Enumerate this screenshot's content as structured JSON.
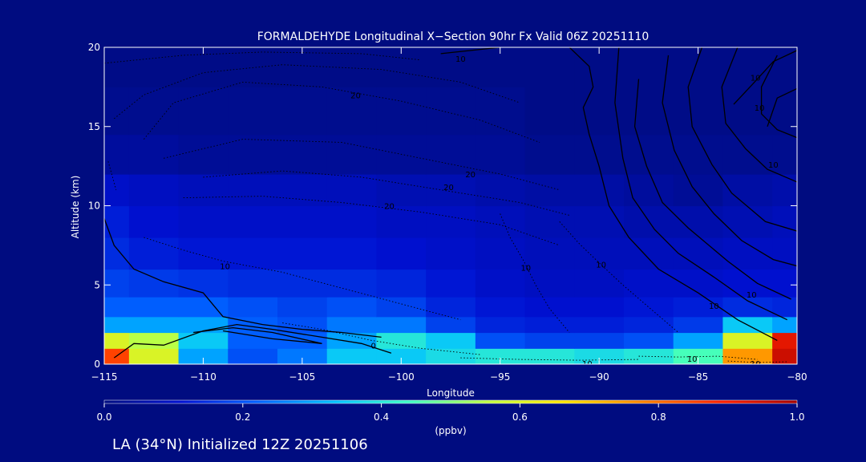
{
  "chart_data": {
    "type": "heatmap",
    "title": "FORMALDEHYDE Longitudinal X−Section 90hr  Fx Valid 06Z 20251110",
    "xlabel": "Longitude",
    "ylabel": "Altitude (km)",
    "xlim": [
      -115,
      -80
    ],
    "ylim": [
      0,
      20
    ],
    "x_ticks": [
      -115,
      -110,
      -105,
      -100,
      -95,
      -90,
      -85,
      -80
    ],
    "x_tick_labels": [
      "−115",
      "−110",
      "−105",
      "−100",
      "−95",
      "−90",
      "−85",
      "−80"
    ],
    "y_ticks": [
      0,
      5,
      10,
      15,
      20
    ],
    "y_tick_labels": [
      "0",
      "5",
      "10",
      "15",
      "20"
    ],
    "colorbar": {
      "label": "(ppbv)",
      "range": [
        0.0,
        1.0
      ],
      "ticks": [
        0.0,
        0.2,
        0.4,
        0.6,
        0.8,
        1.0
      ],
      "tick_labels": [
        "0.0",
        "0.2",
        "0.4",
        "0.6",
        "0.8",
        "1.0"
      ],
      "colors": [
        "#000c80",
        "#0010d0",
        "#0060ff",
        "#00c0ff",
        "#40ffc0",
        "#c0ff40",
        "#ffe000",
        "#ff8000",
        "#ff2000",
        "#a00000"
      ]
    },
    "longitudes": [
      -115,
      -112.5,
      -110,
      -107.5,
      -105,
      -102.5,
      -100,
      -97.5,
      -95,
      -92.5,
      -90,
      -87.5,
      -85,
      -82.5,
      -80
    ],
    "altitude_rows": [
      {
        "z": 0.5,
        "values": [
          0.85,
          0.6,
          0.3,
          0.2,
          0.25,
          0.35,
          0.35,
          0.38,
          0.4,
          0.4,
          0.38,
          0.4,
          0.45,
          0.75,
          0.95
        ]
      },
      {
        "z": 1.5,
        "values": [
          0.6,
          0.55,
          0.35,
          0.22,
          0.22,
          0.3,
          0.4,
          0.35,
          0.2,
          0.18,
          0.18,
          0.2,
          0.3,
          0.6,
          0.92
        ]
      },
      {
        "z": 2.5,
        "values": [
          0.3,
          0.3,
          0.3,
          0.22,
          0.2,
          0.25,
          0.25,
          0.18,
          0.14,
          0.13,
          0.13,
          0.14,
          0.17,
          0.35,
          0.3
        ]
      },
      {
        "z": 3.5,
        "values": [
          0.22,
          0.22,
          0.22,
          0.2,
          0.18,
          0.2,
          0.18,
          0.14,
          0.12,
          0.11,
          0.11,
          0.12,
          0.13,
          0.15,
          0.14
        ]
      },
      {
        "z": 5,
        "values": [
          0.18,
          0.17,
          0.16,
          0.15,
          0.15,
          0.15,
          0.14,
          0.12,
          0.1,
          0.09,
          0.09,
          0.1,
          0.1,
          0.11,
          0.11
        ]
      },
      {
        "z": 7,
        "values": [
          0.15,
          0.13,
          0.12,
          0.12,
          0.12,
          0.12,
          0.11,
          0.1,
          0.09,
          0.08,
          0.08,
          0.08,
          0.08,
          0.09,
          0.09
        ]
      },
      {
        "z": 9,
        "values": [
          0.13,
          0.11,
          0.1,
          0.1,
          0.1,
          0.1,
          0.09,
          0.09,
          0.08,
          0.07,
          0.07,
          0.06,
          0.06,
          0.07,
          0.08
        ]
      },
      {
        "z": 11,
        "values": [
          0.1,
          0.09,
          0.08,
          0.08,
          0.08,
          0.08,
          0.07,
          0.07,
          0.06,
          0.05,
          0.05,
          0.04,
          0.03,
          0.05,
          0.06
        ]
      },
      {
        "z": 13,
        "values": [
          0.04,
          0.04,
          0.03,
          0.03,
          0.03,
          0.03,
          0.03,
          0.03,
          0.03,
          0.02,
          0.02,
          0.02,
          0.02,
          0.02,
          0.02
        ]
      },
      {
        "z": 16,
        "values": [
          0.02,
          0.02,
          0.02,
          0.02,
          0.02,
          0.02,
          0.02,
          0.02,
          0.02,
          0.01,
          0.01,
          0.01,
          0.01,
          0.01,
          0.01
        ]
      },
      {
        "z": 19,
        "values": [
          0.01,
          0.01,
          0.01,
          0.01,
          0.01,
          0.01,
          0.01,
          0.01,
          0.01,
          0.01,
          0.01,
          0.01,
          0.01,
          0.01,
          0.01
        ]
      }
    ],
    "contours": [
      {
        "style": "solid",
        "label": "",
        "label_at": null,
        "points": [
          [
            -115,
            9.2
          ],
          [
            -114.5,
            7.5
          ],
          [
            -113.5,
            6.0
          ],
          [
            -112,
            5.2
          ],
          [
            -110,
            4.5
          ],
          [
            -109,
            3.0
          ],
          [
            -107,
            2.5
          ],
          [
            -105,
            2.2
          ],
          [
            -103,
            2.0
          ],
          [
            -101,
            1.7
          ]
        ]
      },
      {
        "style": "solid",
        "label": "",
        "label_at": null,
        "points": [
          [
            -114.5,
            0.4
          ],
          [
            -113.5,
            1.3
          ],
          [
            -112,
            1.2
          ],
          [
            -110,
            2.1
          ],
          [
            -108.3,
            2.5
          ],
          [
            -106.5,
            2.2
          ],
          [
            -104,
            1.7
          ],
          [
            -102,
            1.3
          ],
          [
            -100.5,
            0.7
          ]
        ]
      },
      {
        "style": "solid",
        "label": "",
        "label_at": null,
        "points": [
          [
            -110.5,
            2.0
          ],
          [
            -108.5,
            2.3
          ],
          [
            -106.5,
            2.0
          ],
          [
            -104,
            1.3
          ],
          [
            -106.5,
            1.6
          ],
          [
            -109,
            2.1
          ]
        ]
      },
      {
        "style": "solid",
        "label": "10",
        "label_at": [
          -97,
          19.3
        ],
        "points": [
          [
            -98,
            19.6
          ],
          [
            -95,
            20
          ]
        ]
      },
      {
        "style": "solid",
        "label": "",
        "label_at": null,
        "points": [
          [
            -91.5,
            20
          ],
          [
            -90.5,
            18.8
          ],
          [
            -90.3,
            17.5
          ],
          [
            -90.8,
            16.2
          ],
          [
            -90.5,
            14.5
          ],
          [
            -90,
            12.5
          ],
          [
            -89.5,
            10.0
          ],
          [
            -88.5,
            8.0
          ],
          [
            -87,
            6.0
          ],
          [
            -85,
            4.5
          ],
          [
            -83,
            2.8
          ],
          [
            -81,
            1.5
          ]
        ]
      },
      {
        "style": "solid",
        "label": "10",
        "label_at": [
          -84.2,
          3.7
        ],
        "points": [
          [
            -89,
            20
          ],
          [
            -89.2,
            16.5
          ],
          [
            -88.8,
            13.0
          ],
          [
            -88.3,
            10.5
          ],
          [
            -87.2,
            8.5
          ],
          [
            -86,
            7.0
          ],
          [
            -84.2,
            5.5
          ],
          [
            -82.5,
            4.0
          ],
          [
            -80.5,
            2.8
          ]
        ]
      },
      {
        "style": "solid",
        "label": "",
        "label_at": null,
        "points": [
          [
            -88,
            18.0
          ],
          [
            -88.2,
            15.0
          ],
          [
            -87.6,
            12.5
          ],
          [
            -86.8,
            10.2
          ],
          [
            -85.5,
            8.6
          ],
          [
            -83.5,
            6.5
          ],
          [
            -82,
            5.1
          ],
          [
            -80.3,
            4.1
          ]
        ]
      },
      {
        "style": "solid",
        "label": "10",
        "label_at": [
          -82.3,
          4.4
        ],
        "points": [
          [
            -86.5,
            19.5
          ],
          [
            -86.8,
            16.5
          ],
          [
            -86.2,
            13.5
          ],
          [
            -85.3,
            11.2
          ],
          [
            -84.2,
            9.5
          ],
          [
            -82.8,
            7.8
          ],
          [
            -81.2,
            6.6
          ],
          [
            -80,
            6.2
          ]
        ]
      },
      {
        "style": "solid",
        "label": "",
        "label_at": null,
        "points": [
          [
            -84.8,
            20
          ],
          [
            -85.5,
            17.5
          ],
          [
            -85.3,
            15.0
          ],
          [
            -84.3,
            12.6
          ],
          [
            -83.3,
            10.8
          ],
          [
            -81.6,
            9.0
          ],
          [
            -80,
            8.4
          ]
        ]
      },
      {
        "style": "solid",
        "label": "",
        "label_at": null,
        "points": [
          [
            -83,
            20
          ],
          [
            -83.8,
            17.5
          ],
          [
            -83.6,
            15.2
          ],
          [
            -82.6,
            13.6
          ],
          [
            -81.5,
            12.3
          ],
          [
            -80,
            11.5
          ]
        ]
      },
      {
        "style": "solid",
        "label": "10",
        "label_at": [
          -81.9,
          16.2
        ],
        "points": [
          [
            -81,
            19.5
          ],
          [
            -81.8,
            17.5
          ],
          [
            -81.8,
            15.8
          ],
          [
            -81,
            14.8
          ],
          [
            -80,
            14.3
          ]
        ]
      },
      {
        "style": "solid",
        "label": "10",
        "label_at": [
          -82.1,
          18.1
        ],
        "points": [
          [
            -80,
            19.8
          ],
          [
            -81.2,
            19.1
          ],
          [
            -82.3,
            17.6
          ],
          [
            -83.2,
            16.4
          ]
        ]
      },
      {
        "style": "solid",
        "label": "10",
        "label_at": [
          -81.2,
          12.6
        ],
        "points": [
          [
            -80,
            17.4
          ],
          [
            -81.0,
            16.8
          ],
          [
            -81.5,
            15.0
          ]
        ]
      },
      {
        "style": "dotted",
        "label": "20",
        "label_at": [
          -102.3,
          17.0
        ],
        "points": [
          [
            -113,
            14.2
          ],
          [
            -111.5,
            16.5
          ],
          [
            -108,
            17.8
          ],
          [
            -104,
            17.5
          ],
          [
            -100,
            16.6
          ],
          [
            -96,
            15.4
          ],
          [
            -93,
            14.0
          ]
        ]
      },
      {
        "style": "dotted",
        "label": "20",
        "label_at": [
          -96.5,
          12.0
        ],
        "points": [
          [
            -112,
            13.0
          ],
          [
            -108,
            14.2
          ],
          [
            -103,
            14.0
          ],
          [
            -99,
            13.0
          ],
          [
            -95,
            12.0
          ],
          [
            -92,
            11.0
          ]
        ]
      },
      {
        "style": "dotted",
        "label": "20",
        "label_at": [
          -97.6,
          11.2
        ],
        "points": [
          [
            -110,
            11.8
          ],
          [
            -106,
            12.2
          ],
          [
            -102,
            11.8
          ],
          [
            -98,
            11.0
          ],
          [
            -94,
            10.2
          ],
          [
            -91.5,
            9.4
          ]
        ]
      },
      {
        "style": "dotted",
        "label": "20",
        "label_at": [
          -100.6,
          10.0
        ],
        "points": [
          [
            -111,
            10.5
          ],
          [
            -107,
            10.6
          ],
          [
            -103,
            10.2
          ],
          [
            -99,
            9.6
          ],
          [
            -95,
            8.8
          ],
          [
            -92,
            7.5
          ]
        ]
      },
      {
        "style": "dotted",
        "label": "10",
        "label_at": [
          -108.9,
          6.2
        ],
        "points": [
          [
            -113,
            8.0
          ],
          [
            -111,
            7.2
          ],
          [
            -109,
            6.5
          ],
          [
            -106,
            5.8
          ],
          [
            -103,
            4.8
          ],
          [
            -100,
            3.8
          ],
          [
            -97,
            2.8
          ]
        ]
      },
      {
        "style": "dotted",
        "label": "10",
        "label_at": [
          -93.7,
          6.1
        ],
        "points": [
          [
            -95,
            9.5
          ],
          [
            -94.5,
            8.0
          ],
          [
            -93.8,
            6.5
          ],
          [
            -93.2,
            5.0
          ],
          [
            -92.5,
            3.5
          ],
          [
            -91.5,
            2.0
          ]
        ]
      },
      {
        "style": "dotted",
        "label": "10",
        "label_at": [
          -89.9,
          6.3
        ],
        "points": [
          [
            -92,
            9.0
          ],
          [
            -91,
            7.6
          ],
          [
            -90,
            6.4
          ],
          [
            -88.8,
            5.0
          ],
          [
            -87.5,
            3.6
          ],
          [
            -86,
            2.0
          ]
        ]
      },
      {
        "style": "dotted",
        "label": "0",
        "label_at": [
          -101.4,
          1.2
        ],
        "points": [
          [
            -106,
            2.6
          ],
          [
            -104,
            2.2
          ],
          [
            -101.5,
            1.5
          ],
          [
            -99,
            1.0
          ],
          [
            -96,
            0.6
          ]
        ]
      },
      {
        "style": "dotted",
        "label": "10",
        "label_at": [
          -90.6,
          0.05
        ],
        "points": [
          [
            -97,
            0.4
          ],
          [
            -94,
            0.3
          ],
          [
            -91,
            0.25
          ],
          [
            -88,
            0.3
          ]
        ]
      },
      {
        "style": "dotted",
        "label": "10",
        "label_at": [
          -85.3,
          0.35
        ],
        "points": [
          [
            -88,
            0.5
          ],
          [
            -86,
            0.45
          ],
          [
            -84,
            0.5
          ],
          [
            -82,
            0.3
          ]
        ]
      },
      {
        "style": "dotted",
        "label": "10",
        "label_at": [
          -82.1,
          0.05
        ],
        "points": [
          [
            -83.5,
            0.2
          ],
          [
            -82,
            0.1
          ],
          [
            -80.5,
            0.15
          ]
        ]
      },
      {
        "style": "dotted",
        "label": "",
        "label_at": null,
        "points": [
          [
            -115,
            19.0
          ],
          [
            -111,
            19.5
          ],
          [
            -107,
            19.7
          ],
          [
            -102,
            19.6
          ],
          [
            -99,
            19.2
          ]
        ]
      },
      {
        "style": "dotted",
        "label": "",
        "label_at": null,
        "points": [
          [
            -114.5,
            15.5
          ],
          [
            -113,
            17.0
          ],
          [
            -110,
            18.4
          ],
          [
            -106,
            18.9
          ],
          [
            -101,
            18.6
          ],
          [
            -97,
            17.8
          ],
          [
            -94,
            16.5
          ]
        ]
      },
      {
        "style": "dotted",
        "label": "",
        "label_at": null,
        "points": [
          [
            -114.8,
            12.8
          ],
          [
            -114.4,
            11.0
          ]
        ]
      }
    ]
  },
  "footer": {
    "init_text": "LA (34°N) Initialized 12Z 20251106"
  }
}
